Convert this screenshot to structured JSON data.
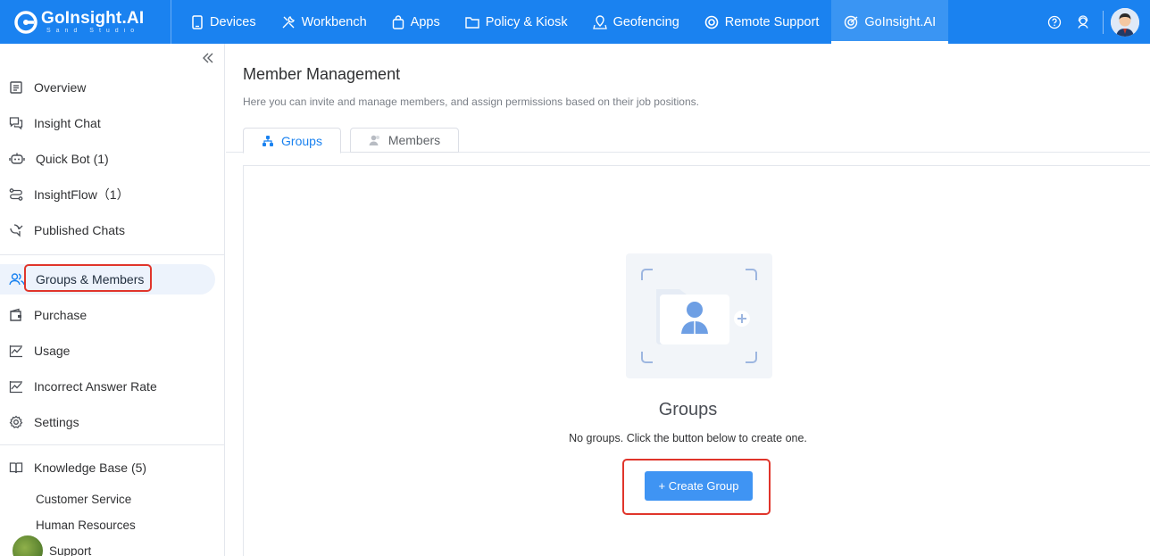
{
  "app": {
    "logo_title": "GoInsight.AI",
    "logo_sub": "Sand Studio"
  },
  "topnav": {
    "items": [
      {
        "label": "Devices",
        "icon": "tablet-icon"
      },
      {
        "label": "Workbench",
        "icon": "tools-icon"
      },
      {
        "label": "Apps",
        "icon": "shopping-bag-icon"
      },
      {
        "label": "Policy & Kiosk",
        "icon": "folder-icon"
      },
      {
        "label": "Geofencing",
        "icon": "map-pin-icon"
      },
      {
        "label": "Remote Support",
        "icon": "lifebuoy-icon"
      },
      {
        "label": "GoInsight.AI",
        "icon": "ai-logo-icon",
        "active": true
      }
    ]
  },
  "sidebar": {
    "items": [
      {
        "label": "Overview",
        "icon": "document-list-icon"
      },
      {
        "label": "Insight Chat",
        "icon": "chat-icon"
      },
      {
        "label": "Quick Bot (1)",
        "icon": "robot-icon"
      },
      {
        "label": "InsightFlow（1）",
        "icon": "flow-icon"
      },
      {
        "label": "Published Chats",
        "icon": "published-chat-icon"
      }
    ],
    "items2": [
      {
        "label": "Groups & Members",
        "icon": "users-icon",
        "active": true
      },
      {
        "label": "Purchase",
        "icon": "wallet-icon"
      },
      {
        "label": "Usage",
        "icon": "chart-line-icon"
      },
      {
        "label": "Incorrect Answer Rate",
        "icon": "chart-line-icon"
      },
      {
        "label": "Settings",
        "icon": "gear-icon"
      }
    ],
    "knowledge_base": {
      "label": "Knowledge Base (5)",
      "items": [
        "Customer Service",
        "Human Resources",
        "Support"
      ]
    }
  },
  "main": {
    "title": "Member Management",
    "description": "Here you can invite and manage members, and assign permissions based on their job positions.",
    "tabs": [
      {
        "label": "Groups",
        "active": true
      },
      {
        "label": "Members"
      }
    ],
    "empty": {
      "title": "Groups",
      "description": "No groups. Click the button below to create one.",
      "button": "+ Create Group"
    }
  },
  "colors": {
    "primary": "#1a82f0",
    "button": "#3f94f3",
    "highlight": "#e0352b"
  }
}
